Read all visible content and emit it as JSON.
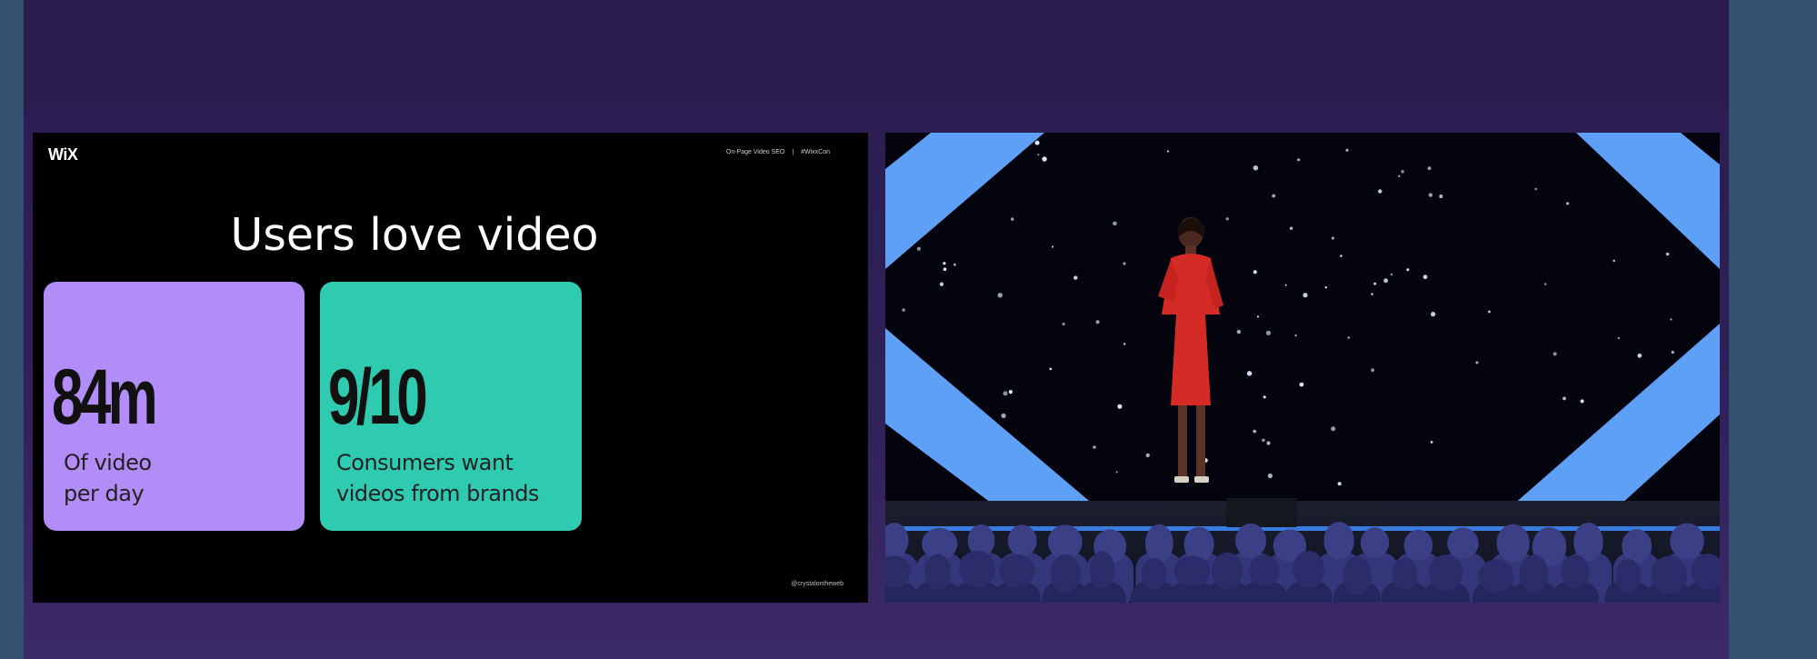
{
  "slide": {
    "logo": "WiX",
    "header_left": "On-Page Video SEO",
    "header_separator": "|",
    "header_right": "#WixxCon",
    "title": "Users love video",
    "stats": [
      {
        "value": "84m",
        "label_line1": "Of video",
        "label_line2": "per day",
        "color": "#b28cf7"
      },
      {
        "value": "9/10",
        "label_line1": "Consumers want",
        "label_line2": "videos from brands",
        "color": "#2ecbb0"
      }
    ],
    "footer": "@crystalontheweb"
  },
  "colors": {
    "frame_bg": "#2e1f55",
    "outer_bg": "#33506f",
    "stage_blue": "#6aa8ff",
    "dress_red": "#d42b26"
  }
}
